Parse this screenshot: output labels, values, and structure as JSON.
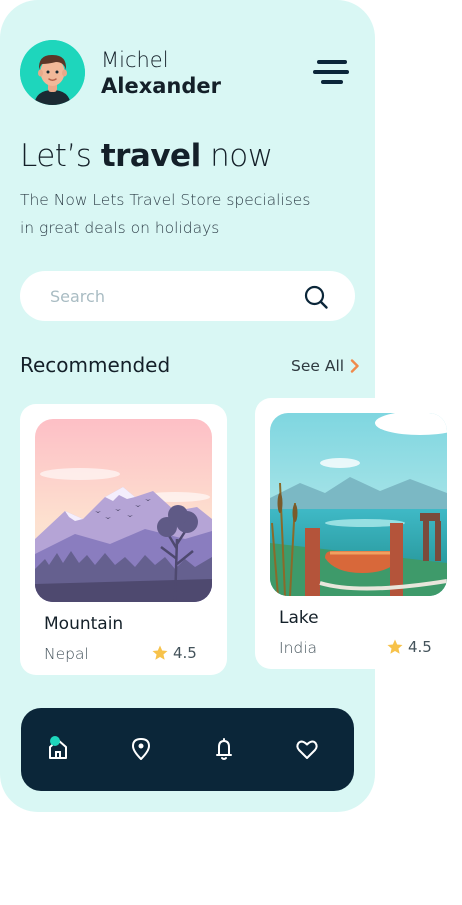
{
  "user": {
    "first_name": "Michel",
    "last_name": "Alexander"
  },
  "headline": {
    "prefix": "Let’s",
    "bold": "travel",
    "suffix": "now"
  },
  "description": "The Now Lets Travel Store specialises in great deals on holidays",
  "search": {
    "placeholder": "Search",
    "value": ""
  },
  "recommended": {
    "title": "Recommended",
    "see_all": "See All",
    "items": [
      {
        "name": "Mountain",
        "location": "Nepal",
        "rating": "4.5"
      },
      {
        "name": "Lake",
        "location": "India",
        "rating": "4.5"
      }
    ]
  },
  "nav": {
    "items": [
      {
        "icon": "home-icon",
        "active": true
      },
      {
        "icon": "location-icon",
        "active": false
      },
      {
        "icon": "bell-icon",
        "active": false
      },
      {
        "icon": "heart-icon",
        "active": false
      }
    ]
  },
  "colors": {
    "background": "#d9f7f4",
    "accent": "#1ed6bc",
    "navbar": "#0b2639",
    "arrow": "#f08a4b",
    "star": "#f7c24a"
  }
}
